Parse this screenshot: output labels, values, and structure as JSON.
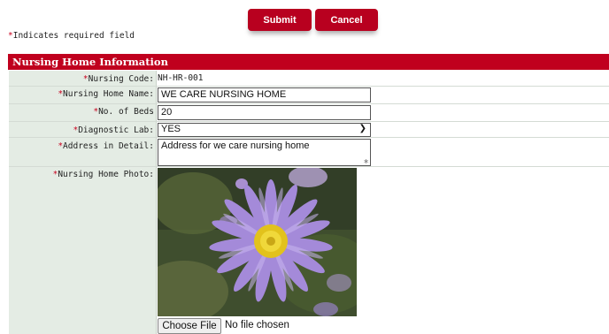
{
  "toolbar": {
    "submit_label": "Submit",
    "cancel_label": "Cancel"
  },
  "required_note": {
    "star": "*",
    "text": "Indicates required field"
  },
  "section": {
    "title": "Nursing Home Information"
  },
  "fields": {
    "code": {
      "label": "Nursing Code:",
      "value": "NH-HR-001"
    },
    "name": {
      "label": "Nursing Home Name:",
      "value": "WE CARE NURSING HOME"
    },
    "beds": {
      "label": "No. of Beds",
      "value": "20"
    },
    "lab": {
      "label": "Diagnostic Lab:",
      "value": "YES",
      "options": [
        "YES"
      ]
    },
    "address": {
      "label": "Address in Detail:",
      "value": "Address for we care nursing home"
    },
    "photo": {
      "label": "Nursing Home Photo:",
      "file_button": "Choose File",
      "file_status": "No file chosen"
    }
  },
  "colors": {
    "accent": "#c0001e",
    "button": "#b8001f",
    "label_bg": "#e4ece4"
  },
  "icons": {
    "select": "chevron-down-icon",
    "resize": "resize-handle-icon"
  }
}
